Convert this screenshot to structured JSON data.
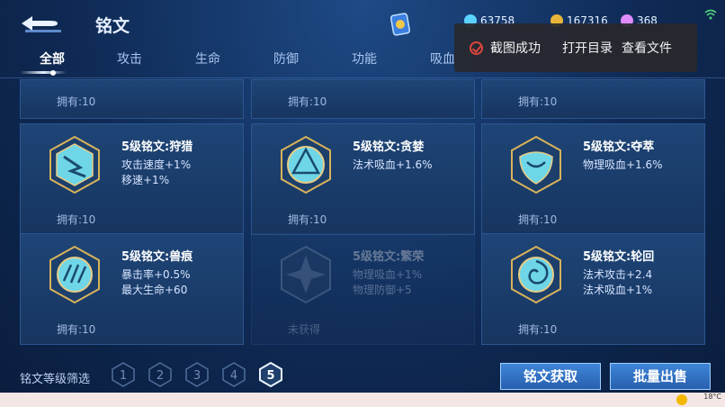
{
  "header": {
    "title": "铭文",
    "currencies": [
      {
        "name": "gem",
        "value": "63758",
        "color": "#5bd3ff"
      },
      {
        "name": "gold",
        "value": "167316",
        "color": "#e8b53a"
      },
      {
        "name": "crystal",
        "value": "368",
        "color": "#e08cff"
      }
    ]
  },
  "tabs": [
    {
      "label": "全部",
      "active": true
    },
    {
      "label": "攻击",
      "active": false
    },
    {
      "label": "生命",
      "active": false
    },
    {
      "label": "防御",
      "active": false
    },
    {
      "label": "功能",
      "active": false
    },
    {
      "label": "吸血",
      "active": false
    }
  ],
  "toast": {
    "message": "截图成功",
    "open_dir": "打开目录",
    "view_file": "查看文件"
  },
  "cards_top": [
    {
      "owned": "拥有:10"
    },
    {
      "owned": "拥有:10"
    },
    {
      "owned": "拥有:10"
    }
  ],
  "cards": [
    {
      "name": "5级铭文:狩猎",
      "stats": [
        "攻击速度+1%",
        "移速+1%"
      ],
      "owned": "拥有:10",
      "locked": false
    },
    {
      "name": "5级铭文:贪婪",
      "stats": [
        "法术吸血+1.6%"
      ],
      "owned": "拥有:10",
      "locked": false
    },
    {
      "name": "5级铭文:夺萃",
      "stats": [
        "物理吸血+1.6%"
      ],
      "owned": "拥有:10",
      "locked": false
    },
    {
      "name": "5级铭文:兽痕",
      "stats": [
        "暴击率+0.5%",
        "最大生命+60"
      ],
      "owned": "拥有:10",
      "locked": false
    },
    {
      "name": "5级铭文:繁荣",
      "stats": [
        "物理吸血+1%",
        "物理防御+5"
      ],
      "owned": "未获得",
      "locked": true
    },
    {
      "name": "5级铭文:轮回",
      "stats": [
        "法术攻击+2.4",
        "法术吸血+1%"
      ],
      "owned": "拥有:10",
      "locked": false
    }
  ],
  "footer": {
    "filter_label": "铭文等级筛选",
    "levels": [
      "1",
      "2",
      "3",
      "4",
      "5"
    ],
    "selected_level": "5",
    "obtain_button": "铭文获取",
    "sell_button": "批量出售"
  },
  "taskbar": {
    "weather": "18°C"
  }
}
